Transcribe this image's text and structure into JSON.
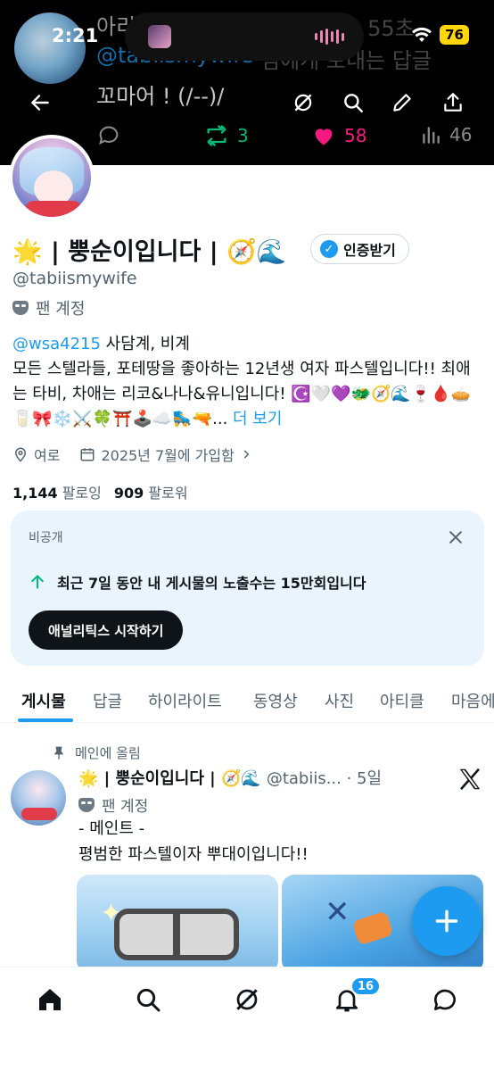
{
  "status_bar": {
    "time": "2:21",
    "battery": "76"
  },
  "header_ghost": {
    "name": "아리",
    "handle": "hiTabi · 55초",
    "reply_to": "@tabiismywife",
    "reply_tail": "님에게 보내는 답글",
    "text": "꼬마어 ! (/--)/",
    "retweets": "3",
    "likes": "58",
    "views": "46"
  },
  "profile": {
    "display_name": "🌟 | 뿡순이입니다 | 🧭🌊",
    "verify_label": "인증받기",
    "handle": "@tabiismywife",
    "account_type": "팬 계정",
    "bio_mention": "@wsa4215",
    "bio_line1_rest": " 사담계, 비계",
    "bio_line2": "모든 스텔라들, 포테땅을 좋아하는 12년생 여자 파스텔입니다!! 최애는 타비, 차애는 리코&나나&유니입니다! ☪️🤍💜🐲🧭🌊🍷🩸🥧🥛🎀❄️⚔️🍀⛩️🕹️☁️🛼🔫...",
    "bio_more": " 더 보기",
    "location": "여로",
    "joined": "2025년 7월에 가입함",
    "following_count": "1,144",
    "following_label": "팔로잉",
    "followers_count": "909",
    "followers_label": "팔로워"
  },
  "analytics_card": {
    "private_label": "비공개",
    "message": "최근 7일 동안 내 게시물의 노출수는 15만회입니다",
    "button": "애널리틱스 시작하기"
  },
  "tabs": [
    "게시물",
    "답글",
    "하이라이트",
    "동영상",
    "사진",
    "아티클",
    "마음에 들어요"
  ],
  "pinned_post": {
    "pinned_label": "메인에 올림",
    "name": "🌟 | 뿡순이입니다 | 🧭🌊",
    "meta": "@tabiis... · 5일",
    "account_type": "팬 계정",
    "line1": "- 메인트 -",
    "line2": "평범한 파스텔이자 뿌대이입니다!!"
  },
  "bottom_nav": {
    "notifications_badge": "16"
  },
  "colors": {
    "accent": "#1d9bf0",
    "like": "#f91880",
    "retweet": "#00ba7c",
    "header_bg": "#000000"
  }
}
